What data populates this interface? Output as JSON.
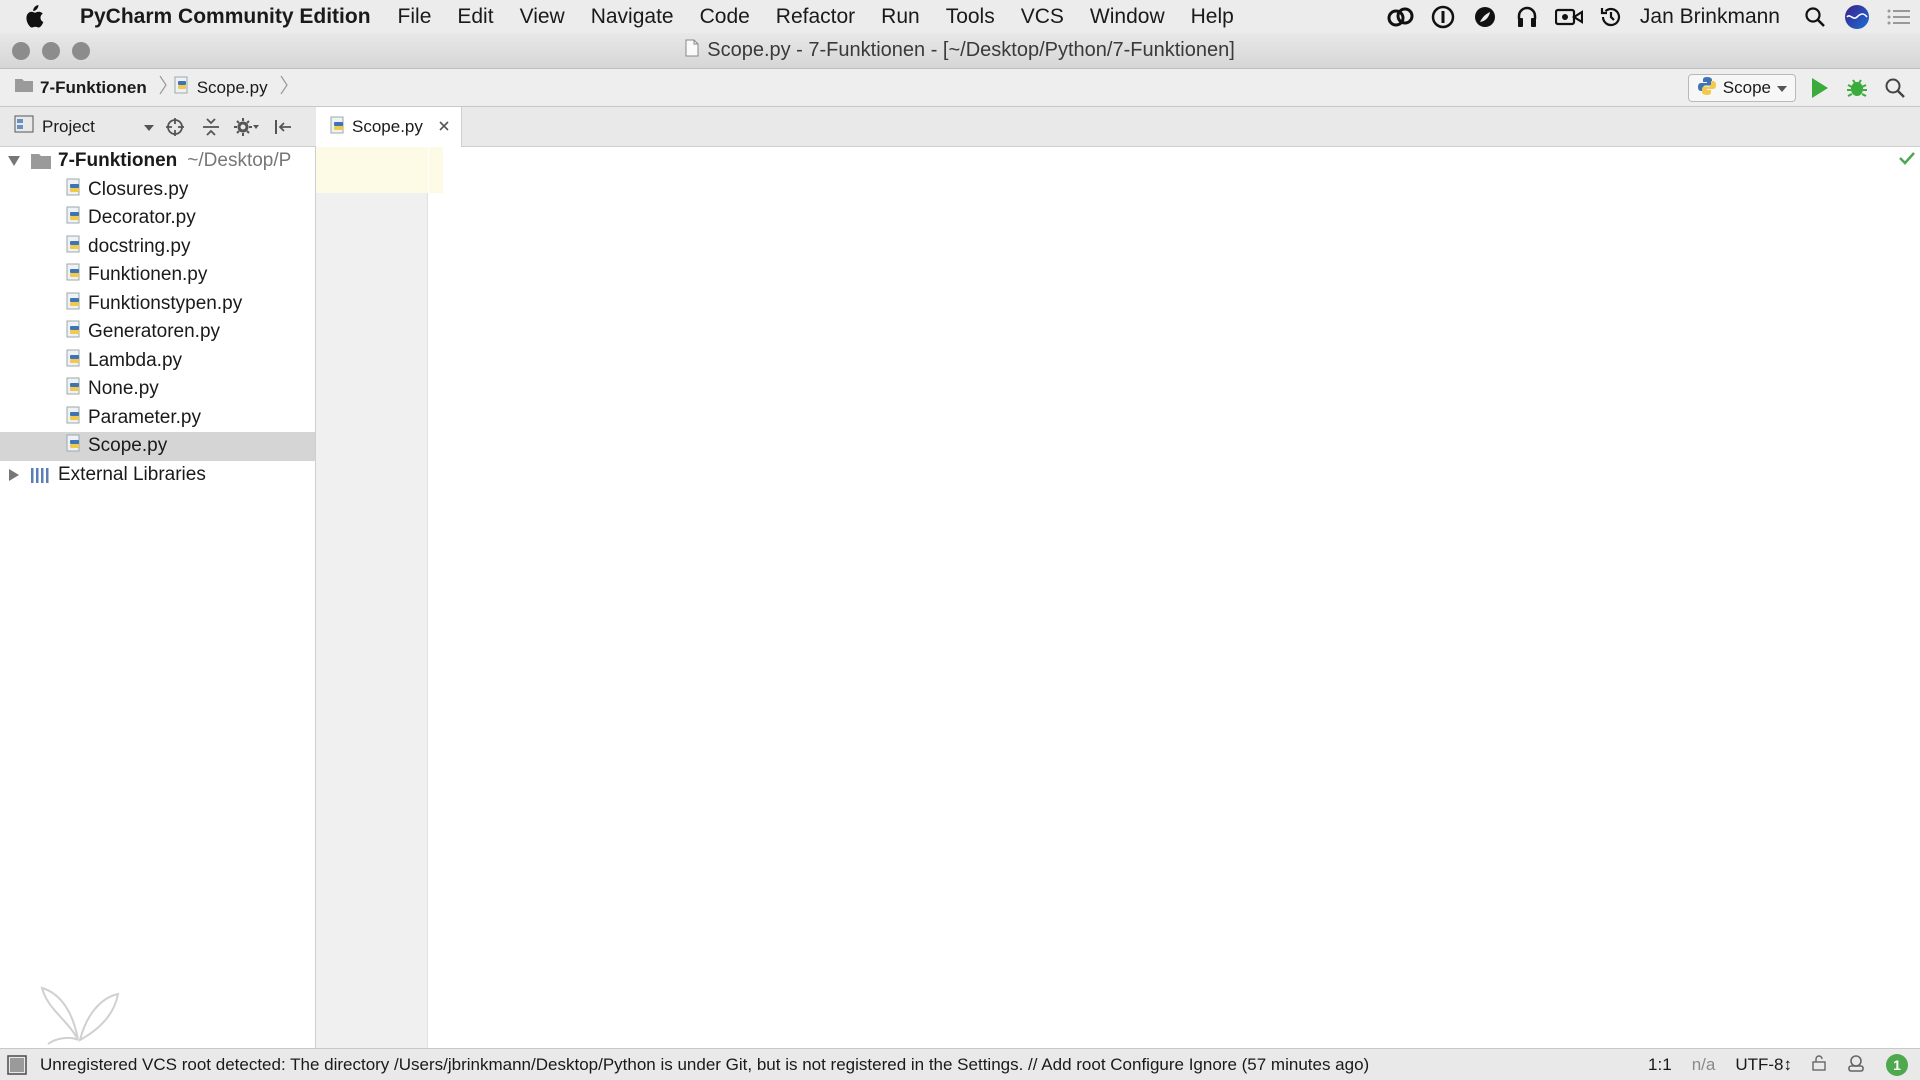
{
  "menubar": {
    "app_name": "PyCharm Community Edition",
    "items": [
      "File",
      "Edit",
      "View",
      "Navigate",
      "Code",
      "Refactor",
      "Run",
      "Tools",
      "VCS",
      "Window",
      "Help"
    ],
    "user": "Jan Brinkmann"
  },
  "window": {
    "title": "Scope.py - 7-Funktionen - [~/Desktop/Python/7-Funktionen]"
  },
  "breadcrumb": {
    "project": "7-Funktionen",
    "file": "Scope.py"
  },
  "run_config": {
    "label": "Scope"
  },
  "project_panel": {
    "view_label": "Project",
    "root": {
      "name": "7-Funktionen",
      "path": "~/Desktop/P"
    },
    "files": [
      "Closures.py",
      "Decorator.py",
      "docstring.py",
      "Funktionen.py",
      "Funktionstypen.py",
      "Generatoren.py",
      "Lambda.py",
      "None.py",
      "Parameter.py",
      "Scope.py"
    ],
    "selected_file": "Scope.py",
    "external": "External Libraries"
  },
  "editor": {
    "active_tab": "Scope.py"
  },
  "statusbar": {
    "message": "Unregistered VCS root detected: The directory /Users/jbrinkmann/Desktop/Python is under Git, but is not registered in the Settings. // Add root  Configure  Ignore (57 minutes ago)",
    "position": "1:1",
    "na": "n/a",
    "encoding": "UTF-8↕",
    "notifications": "1"
  },
  "colors": {
    "run_green": "#3bab3b",
    "debug_green": "#3bab3b",
    "check_green": "#4ea94e",
    "selection": "#d5d5d5",
    "caret_line": "#fdfbe6"
  }
}
